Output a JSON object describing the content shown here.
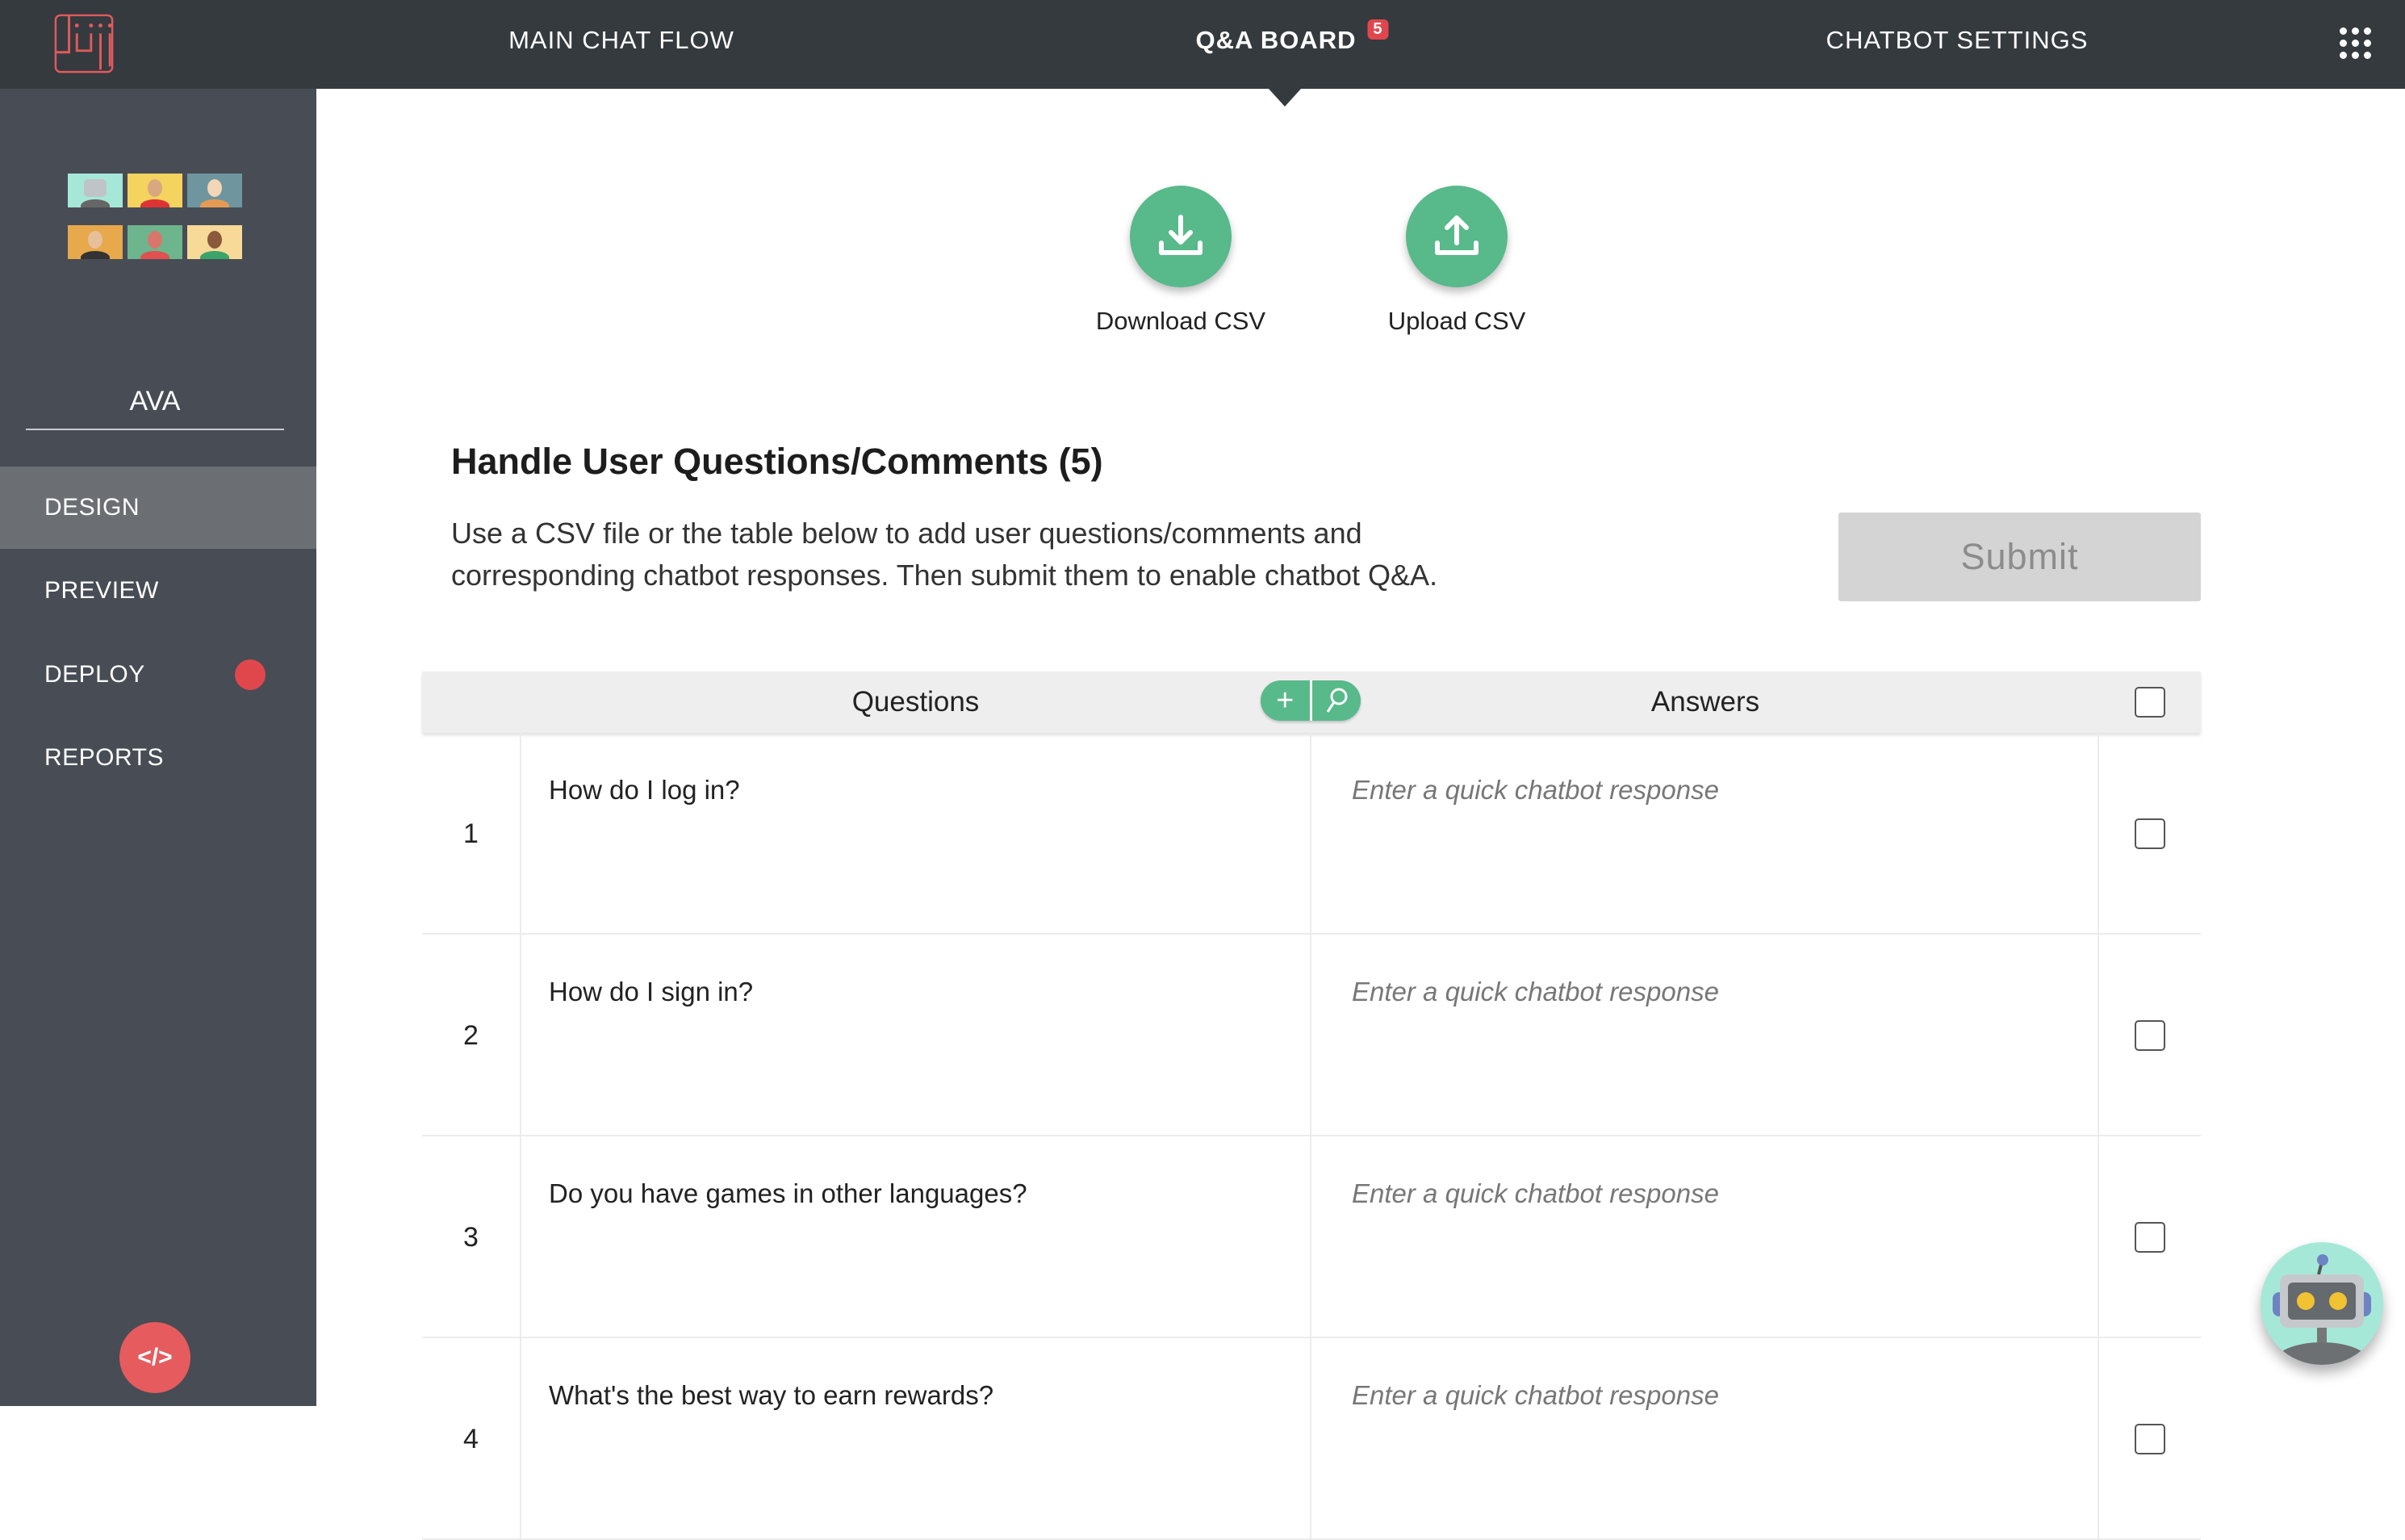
{
  "topbar": {
    "logo_text": "Juji",
    "nav": [
      {
        "label": "MAIN CHAT FLOW"
      },
      {
        "label": "Q&A BOARD",
        "badge": "5"
      },
      {
        "label": "CHATBOT SETTINGS"
      }
    ],
    "apps_icon": "grid-icon"
  },
  "sidebar": {
    "bot_name": "AVA",
    "items": [
      {
        "label": "DESIGN"
      },
      {
        "label": "PREVIEW"
      },
      {
        "label": "DEPLOY"
      },
      {
        "label": "REPORTS"
      }
    ],
    "code_button": "</>"
  },
  "actions": {
    "download": "Download CSV",
    "upload": "Upload CSV"
  },
  "section": {
    "title": "Handle User Questions/Comments (5)",
    "description": "Use a CSV file or the table below to add user questions/comments and corresponding chatbot responses. Then submit them to enable chatbot Q&A.",
    "submit": "Submit"
  },
  "table": {
    "headers": {
      "questions": "Questions",
      "answers": "Answers"
    },
    "add_icon": "+",
    "rows": [
      {
        "num": "1",
        "question": "How do I log in?",
        "answer_placeholder": "Enter a quick chatbot response"
      },
      {
        "num": "2",
        "question": "How do I sign in?",
        "answer_placeholder": "Enter a quick chatbot response"
      },
      {
        "num": "3",
        "question": "Do you have games in other languages?",
        "answer_placeholder": "Enter a quick chatbot response"
      },
      {
        "num": "4",
        "question": "What's the best way to earn rewards?",
        "answer_placeholder": "Enter a quick chatbot response"
      }
    ]
  },
  "colors": {
    "accent_green": "#58b98b",
    "topbar": "#353a3f",
    "sidebar": "#484c54",
    "red": "#e0474c"
  }
}
